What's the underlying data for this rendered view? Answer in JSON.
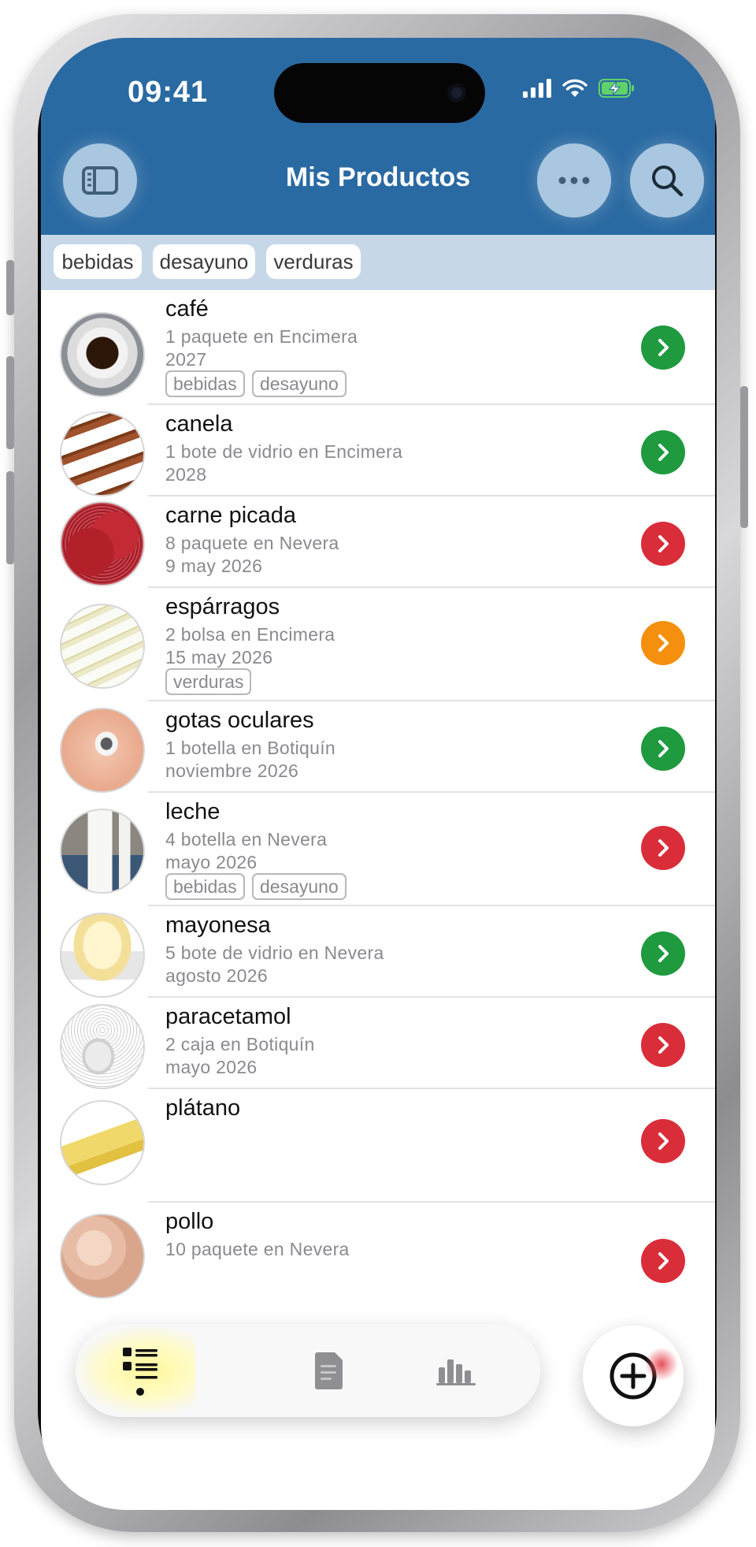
{
  "status_bar": {
    "time": "09:41"
  },
  "header": {
    "title": "Mis Productos"
  },
  "filters": [
    "bebidas",
    "desayuno",
    "verduras"
  ],
  "products": [
    {
      "name": "café",
      "line1": "1 paquete en Encimera",
      "line2": "2027",
      "tags": [
        "bebidas",
        "desayuno"
      ],
      "status": "green"
    },
    {
      "name": "canela",
      "line1": "1 bote de vidrio en Encimera",
      "line2": "2028",
      "tags": [],
      "status": "green"
    },
    {
      "name": "carne picada",
      "line1": "8 paquete en Nevera",
      "line2": "9 may 2026",
      "tags": [],
      "status": "red"
    },
    {
      "name": "espárragos",
      "line1": "2 bolsa en Encimera",
      "line2": "15 may 2026",
      "tags": [
        "verduras"
      ],
      "status": "orange"
    },
    {
      "name": "gotas oculares",
      "line1": "1 botella en Botiquín",
      "line2": "noviembre 2026",
      "tags": [],
      "status": "green"
    },
    {
      "name": "leche",
      "line1": "4 botella en Nevera",
      "line2": "mayo 2026",
      "tags": [
        "bebidas",
        "desayuno"
      ],
      "status": "red"
    },
    {
      "name": "mayonesa",
      "line1": "5 bote de vidrio en Nevera",
      "line2": "agosto 2026",
      "tags": [],
      "status": "green"
    },
    {
      "name": "paracetamol",
      "line1": "2 caja en Botiquín",
      "line2": "mayo 2026",
      "tags": [],
      "status": "red"
    },
    {
      "name": "plátano",
      "line1": "",
      "line2": "",
      "tags": [],
      "status": "red"
    },
    {
      "name": "pollo",
      "line1": "10 paquete en Nevera",
      "line2": "",
      "tags": [],
      "status": "red"
    }
  ],
  "status_colors": {
    "green": "#1f9a3e",
    "red": "#d92e3a",
    "orange": "#f5900f"
  },
  "header_color": "#2a6aa2",
  "tabbar": {
    "tabs": [
      {
        "icon": "list-icon",
        "active": true
      },
      {
        "icon": "document-icon",
        "active": false
      },
      {
        "icon": "bar-chart-icon",
        "active": false
      }
    ],
    "fab_icon": "add-icon"
  }
}
